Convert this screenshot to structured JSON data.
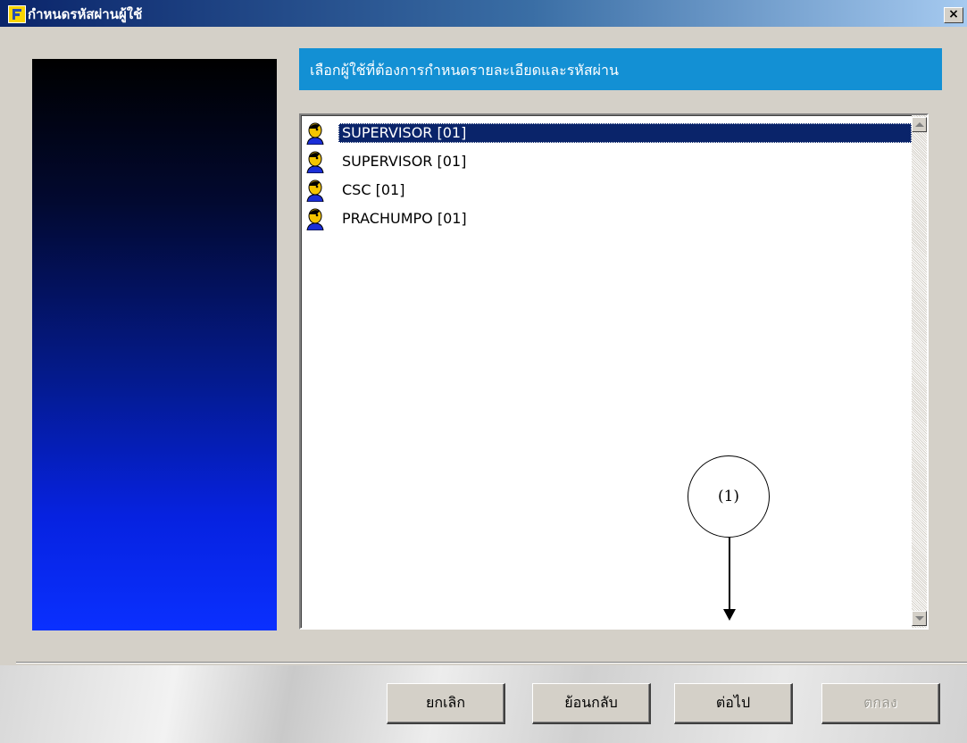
{
  "window": {
    "title": "กำหนดรหัสผ่านผู้ใช้",
    "close_label": "×"
  },
  "header": {
    "text": "เลือกผู้ใช้ที่ต้องการกำหนดรายละเอียดและรหัสผ่าน",
    "color": "#1390d4"
  },
  "user_list": {
    "items": [
      {
        "label": "SUPERVISOR [01]",
        "icon": "user-icon",
        "selected": true
      },
      {
        "label": "SUPERVISOR [01]",
        "icon": "user-icon",
        "selected": false
      },
      {
        "label": "CSC [01]",
        "icon": "user-icon",
        "selected": false
      },
      {
        "label": "PRACHUMPO [01]",
        "icon": "user-icon",
        "selected": false
      }
    ]
  },
  "annotation": {
    "label": "(1)"
  },
  "buttons": {
    "cancel": "ยกเลิก",
    "back": "ย้อนกลับ",
    "next": "ต่อไป",
    "ok": "ตกลง",
    "ok_disabled": true
  },
  "colors": {
    "selection": "#0a246a",
    "title_bar_start": "#0a246a",
    "title_bar_end": "#a6caf0"
  }
}
